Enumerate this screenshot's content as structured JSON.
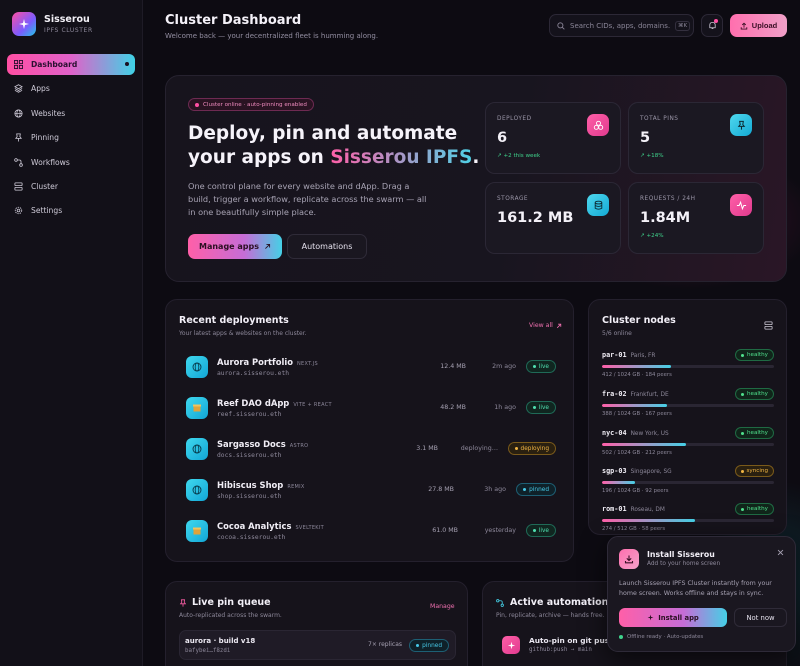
{
  "brand": {
    "name": "Sisserou",
    "subtitle": "IPFS CLUSTER"
  },
  "sidebar": {
    "items": [
      {
        "label": "Dashboard",
        "icon": "grid-icon",
        "active": true
      },
      {
        "label": "Apps",
        "icon": "apps-icon"
      },
      {
        "label": "Websites",
        "icon": "globe-icon"
      },
      {
        "label": "Pinning",
        "icon": "pin-icon"
      },
      {
        "label": "Workflows",
        "icon": "workflow-icon"
      },
      {
        "label": "Cluster",
        "icon": "server-icon"
      },
      {
        "label": "Settings",
        "icon": "gear-icon"
      }
    ]
  },
  "header": {
    "title": "Cluster Dashboard",
    "subtitle": "Welcome back — your decentralized fleet is humming along.",
    "search_placeholder": "Search CIDs, apps, domains…",
    "search_shortcut": "⌘K",
    "upload_label": "Upload"
  },
  "hero": {
    "badge": "Cluster online · auto-pinning enabled",
    "heading_line1": "Deploy, pin and automate",
    "heading_prefix": "your apps on ",
    "heading_highlight": "Sisserou IPFS",
    "heading_suffix": ".",
    "description": "One control plane for every website and dApp. Drag a build, trigger a workflow, replicate across the swarm — all in one beautifully simple place.",
    "primary_button": "Manage apps",
    "secondary_button": "Automations"
  },
  "stats": [
    {
      "label": "DEPLOYED",
      "value": "6",
      "delta": "+2 this week",
      "icon": "cubes-icon"
    },
    {
      "label": "TOTAL PINS",
      "value": "5",
      "delta": "+18%",
      "icon": "pin-icon"
    },
    {
      "label": "STORAGE",
      "value": "161.2 MB",
      "delta": "",
      "icon": "database-icon"
    },
    {
      "label": "REQUESTS / 24H",
      "value": "1.84M",
      "delta": "+24%",
      "icon": "pulse-icon"
    }
  ],
  "deployments": {
    "title": "Recent deployments",
    "subtitle": "Your latest apps & websites on the cluster.",
    "view_all": "View all",
    "rows": [
      {
        "name": "Aurora Portfolio",
        "tag": "NEXT.JS",
        "domain": "aurora.sisserou.eth",
        "size": "12.4 MB",
        "time": "2m ago",
        "status": "live",
        "icon": "globe-icon"
      },
      {
        "name": "Reef DAO dApp",
        "tag": "VITE + REACT",
        "domain": "reef.sisserou.eth",
        "size": "48.2 MB",
        "time": "1h ago",
        "status": "live",
        "icon": "box-icon"
      },
      {
        "name": "Sargasso Docs",
        "tag": "ASTRO",
        "domain": "docs.sisserou.eth",
        "size": "3.1 MB",
        "time": "deploying…",
        "status": "deploying",
        "icon": "globe-icon"
      },
      {
        "name": "Hibiscus Shop",
        "tag": "REMIX",
        "domain": "shop.sisserou.eth",
        "size": "27.8 MB",
        "time": "3h ago",
        "status": "pinned",
        "icon": "globe-icon"
      },
      {
        "name": "Cocoa Analytics",
        "tag": "SVELTEKIT",
        "domain": "cocoa.sisserou.eth",
        "size": "61.0 MB",
        "time": "yesterday",
        "status": "live",
        "icon": "box-icon"
      }
    ]
  },
  "nodes": {
    "title": "Cluster nodes",
    "subtitle": "5/6 online",
    "items": [
      {
        "id": "par-01",
        "location": "Paris, FR",
        "status": "healthy",
        "usage": 0.4,
        "meta": "412 / 1024 GB · 184 peers"
      },
      {
        "id": "fra-02",
        "location": "Frankfurt, DE",
        "status": "healthy",
        "usage": 0.38,
        "meta": "388 / 1024 GB · 167 peers"
      },
      {
        "id": "nyc-04",
        "location": "New York, US",
        "status": "healthy",
        "usage": 0.49,
        "meta": "502 / 1024 GB · 212 peers"
      },
      {
        "id": "sgp-03",
        "location": "Singapore, SG",
        "status": "syncing",
        "usage": 0.19,
        "meta": "196 / 1024 GB · 92 peers"
      },
      {
        "id": "rom-01",
        "location": "Roseau, DM",
        "status": "healthy",
        "usage": 0.54,
        "meta": "274 / 512 GB · 58 peers"
      }
    ]
  },
  "queue": {
    "title": "Live pin queue",
    "subtitle": "Auto-replicated across the swarm.",
    "manage": "Manage",
    "item": {
      "name": "aurora · build v18",
      "cid": "bafybei…f8zdi",
      "replicas": "7× replicas",
      "status": "pinned"
    }
  },
  "automations": {
    "title": "Active automations",
    "subtitle": "Pin, replicate, archive — hands free.",
    "item": {
      "name": "Auto-pin on git push",
      "trigger": "github:push → main"
    }
  },
  "install": {
    "title": "Install Sisserou",
    "subtitle": "Add to your home screen",
    "description": "Launch Sisserou IPFS Cluster instantly from your home screen. Works offline and stays in sync.",
    "install_label": "Install app",
    "dismiss_label": "Not now",
    "footer": "Offline ready · Auto-updates"
  },
  "colors": {
    "accent_pink": "#ff5fa8",
    "accent_cyan": "#45d0e6",
    "success": "#4fe08c",
    "warning": "#f1b544",
    "background": "#0d0b12"
  }
}
